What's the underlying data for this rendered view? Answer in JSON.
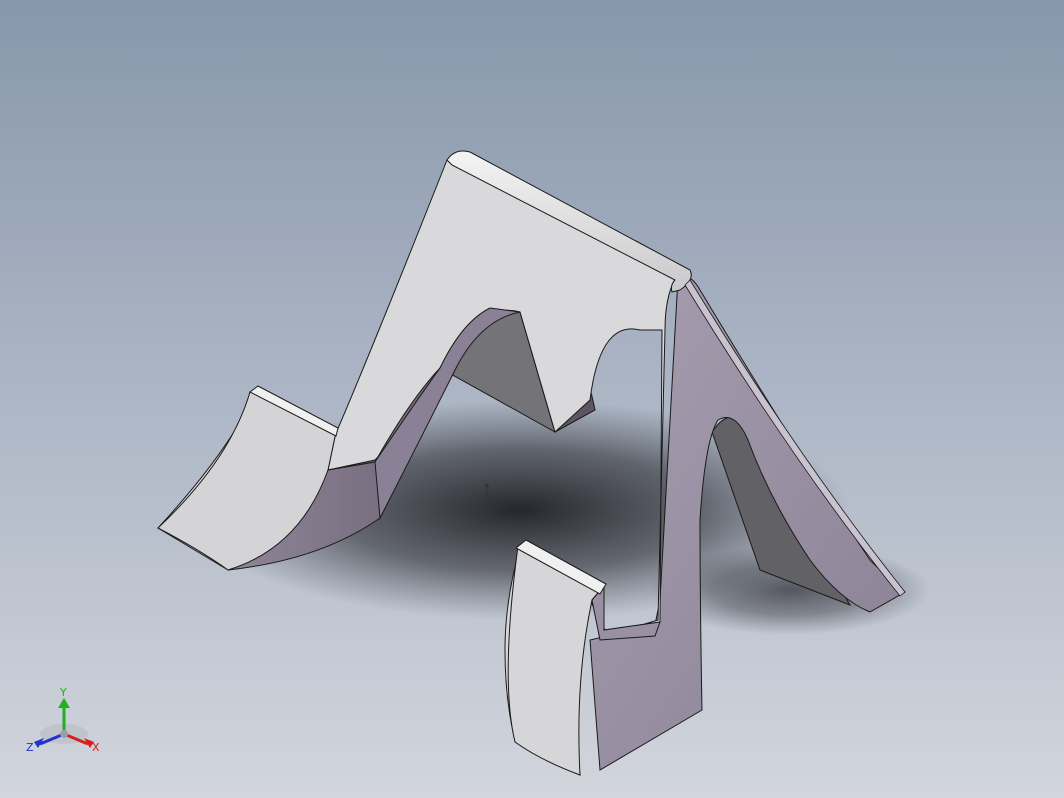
{
  "viewport": {
    "background_top": "#8797ab",
    "background_bottom": "#d2d5dc"
  },
  "model": {
    "face_light": "#d8d8da",
    "face_side": "#9a90a3",
    "face_dark": "#6e6e73",
    "edge": "#1a1a1a"
  },
  "triad": {
    "x_label": "X",
    "y_label": "Y",
    "z_label": "Z",
    "x_color": "#d42020",
    "y_color": "#22b022",
    "z_color": "#2232d0"
  },
  "origin_marker": {
    "icon": "origin-icon"
  }
}
